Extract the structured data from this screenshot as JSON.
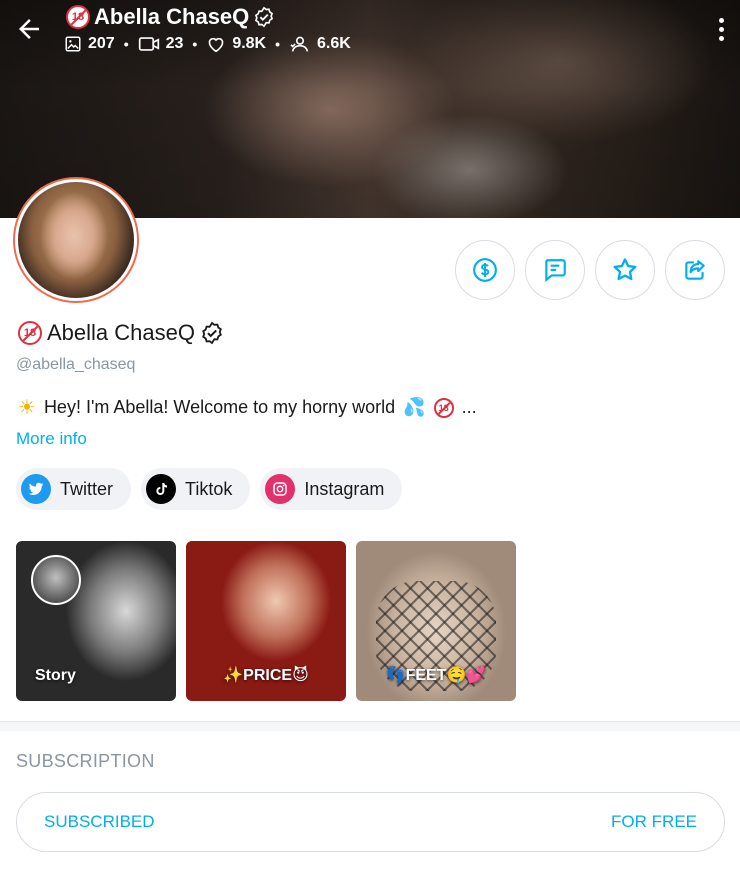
{
  "header": {
    "title": "Abella ChaseQ",
    "stats": {
      "photos": "207",
      "videos": "23",
      "likes": "9.8K",
      "fans": "6.6K"
    },
    "separator": "•"
  },
  "badge": {
    "label": "18"
  },
  "profile": {
    "name": "Abella ChaseQ",
    "handle": "@abella_chaseq",
    "bio": "Hey! I'm Abella! Welcome to my horny world",
    "bio_emoji_start": "☀",
    "bio_emoji_end": "💦",
    "bio_ellipsis": "...",
    "more_info": "More info"
  },
  "socials": [
    {
      "label": "Twitter",
      "icon": "twitter-icon",
      "color": "#1d9bf0"
    },
    {
      "label": "Tiktok",
      "icon": "tiktok-icon",
      "color": "#000000"
    },
    {
      "label": "Instagram",
      "icon": "instagram-icon",
      "color": "#e1306c"
    }
  ],
  "highlights": [
    {
      "label": "Story"
    },
    {
      "label": "✨PRICE😈"
    },
    {
      "label": "👣FEET🤤💕"
    }
  ],
  "subscription": {
    "section_title": "SUBSCRIPTION",
    "status": "SUBSCRIBED",
    "price": "FOR FREE"
  },
  "colors": {
    "accent": "#00aff0",
    "muted": "#8a96a3",
    "avatar_ring": "#ee6b4d",
    "adult_badge": "#e0303f"
  }
}
